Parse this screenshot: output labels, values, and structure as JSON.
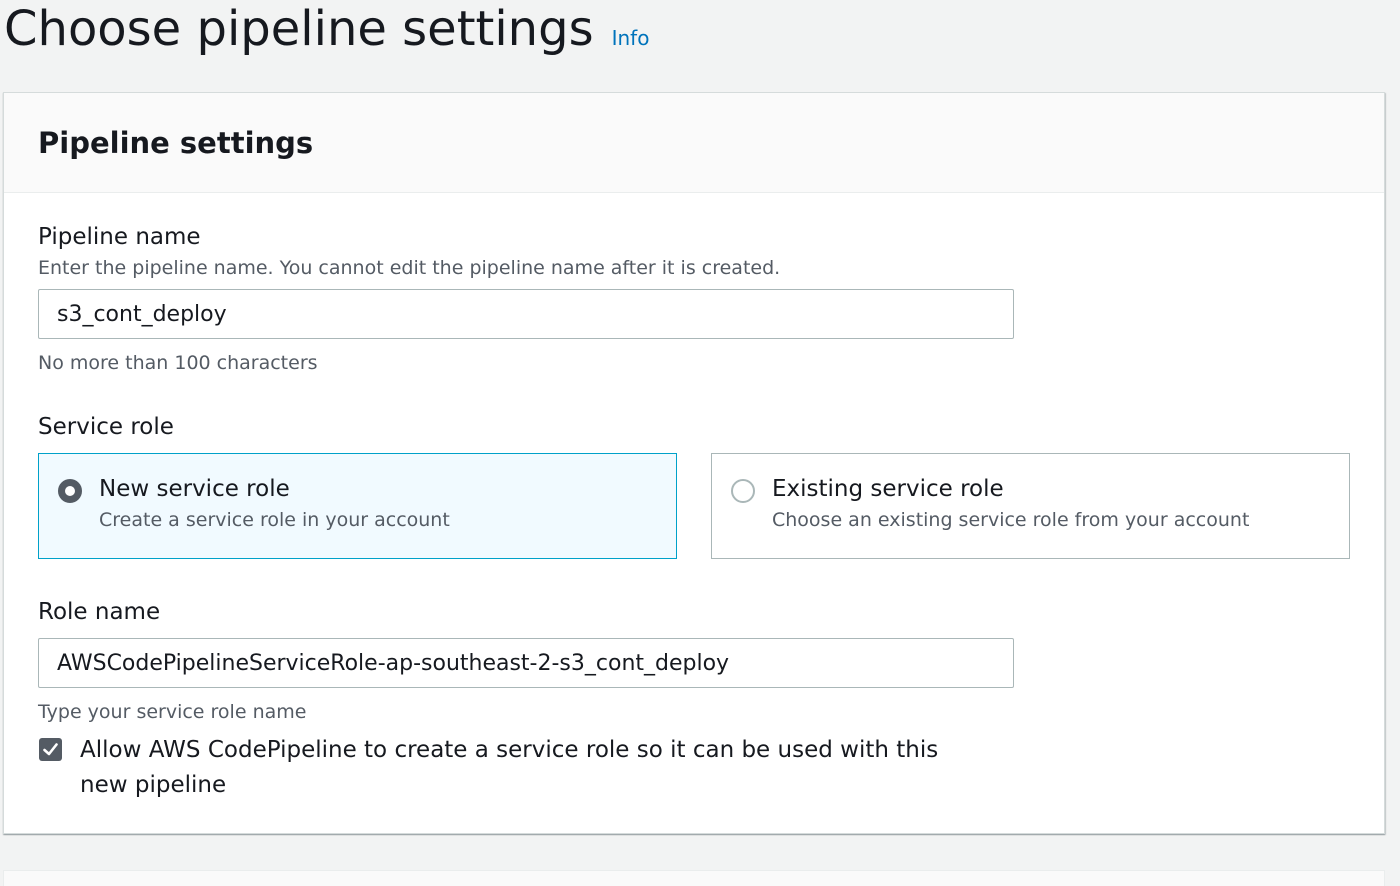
{
  "header": {
    "title": "Choose pipeline settings",
    "info_label": "Info"
  },
  "panel": {
    "title": "Pipeline settings"
  },
  "pipeline_name": {
    "label": "Pipeline name",
    "description": "Enter the pipeline name. You cannot edit the pipeline name after it is created.",
    "value": "s3_cont_deploy",
    "constraint": "No more than 100 characters"
  },
  "service_role": {
    "label": "Service role",
    "options": [
      {
        "title": "New service role",
        "description": "Create a service role in your account",
        "selected": true
      },
      {
        "title": "Existing service role",
        "description": "Choose an existing service role from your account",
        "selected": false
      }
    ]
  },
  "role_name": {
    "label": "Role name",
    "value": "AWSCodePipelineServiceRole-ap-southeast-2-s3_cont_deploy",
    "hint": "Type your service role name"
  },
  "allow_checkbox": {
    "label": "Allow AWS CodePipeline to create a service role so it can be used with this new pipeline",
    "checked": true
  },
  "colors": {
    "page_background": "#f2f3f3",
    "link": "#0073bb",
    "selected_border": "#00a1c9",
    "selected_background": "#f1faff",
    "control_dark": "#545b64",
    "secondary_text": "#545b64"
  },
  "icons": {
    "checkbox": "checkmark-icon",
    "radio": "radio-icon"
  }
}
